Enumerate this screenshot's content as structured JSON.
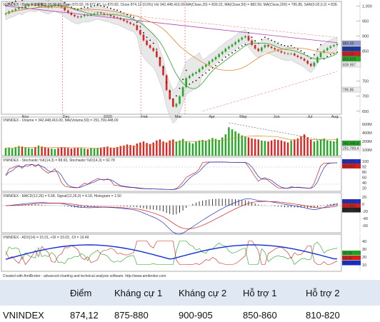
{
  "chart_data": [
    {
      "type": "candlestick",
      "title": "VNINDEX - Daily 8/25/2020 00:00:00 Open 870.92, Hi 877.37, Lo 870.82, Close 874.12 (0.6%) Vol 342,448,416.00 MA(Close,20) = 839.22, MA(Close,50) = 882.59, MA(Close,200) = 795.85, SAR(0.02,0.2) = 839.",
      "x_labels": [
        "Nov",
        "Dec",
        "2020",
        "Feb",
        "Mar",
        "Apr",
        "May",
        "Jun",
        "Jul",
        "Aug"
      ],
      "y_ticks": [
        1000,
        950,
        900,
        850,
        750,
        700,
        650
      ],
      "price_tags": [
        "882.59",
        "874.13",
        "873.94",
        "853.629",
        "839.957",
        "795.85"
      ],
      "close": [
        975,
        982,
        985,
        990,
        996,
        993,
        1000,
        1004,
        1005,
        1002,
        1008,
        1002,
        998,
        995,
        1000,
        1004,
        1000,
        995,
        985,
        978,
        970,
        965,
        962,
        966,
        970,
        968,
        972,
        975,
        978,
        975,
        972,
        970,
        966,
        962,
        960,
        955,
        950,
        945,
        940,
        936,
        920,
        905,
        885,
        870,
        860,
        850,
        830,
        800,
        770,
        720,
        690,
        665,
        675,
        700,
        730,
        760,
        768,
        775,
        780,
        790,
        798,
        805,
        815,
        822,
        830,
        840,
        848,
        858,
        865,
        872,
        880,
        888,
        895,
        900,
        885,
        870,
        858,
        850,
        862,
        870,
        865,
        860,
        855,
        850,
        845,
        842,
        840,
        842,
        835,
        830,
        825,
        818,
        808,
        800,
        812,
        830,
        845,
        852,
        860,
        866,
        870,
        874
      ],
      "ma50": [
        null,
        null,
        null,
        null,
        null,
        null,
        null,
        null,
        null,
        null,
        null,
        null,
        null,
        null,
        null,
        null,
        null,
        null,
        null,
        null,
        null,
        null,
        null,
        null,
        null,
        null,
        null,
        null,
        null,
        null,
        null,
        null,
        null,
        null,
        null,
        null,
        null,
        null,
        null,
        null,
        null,
        null,
        null,
        null,
        null,
        null,
        null,
        null,
        null,
        null,
        null,
        null,
        null,
        null,
        null,
        null,
        null,
        null,
        null,
        null,
        null,
        null,
        null,
        null,
        null,
        null,
        null,
        null,
        null,
        null,
        null,
        null,
        null,
        null,
        null,
        null,
        null,
        null,
        null,
        null,
        null,
        null,
        null,
        null,
        null,
        null,
        null,
        null,
        null,
        null,
        null,
        null,
        null,
        null,
        null,
        null,
        null,
        null,
        null,
        null,
        null,
        882.59
      ],
      "ma200": 795.85,
      "ma20": 839.22
    },
    {
      "type": "bar",
      "title": "VNINDEX - Volume = 342,448,416.00, MA(Volume,50) = 251,769,448.00",
      "y_ticks": [
        "600M",
        "400M",
        "200M",
        "100M"
      ],
      "price_tags": [
        "342,448,4",
        "251,769,4"
      ],
      "values": [
        150,
        160,
        140,
        170,
        190,
        180,
        160,
        150,
        140,
        170,
        200,
        180,
        160,
        150,
        140,
        130,
        150,
        170,
        160,
        150,
        140,
        150,
        160,
        150,
        140,
        130,
        150,
        140,
        150,
        160,
        170,
        180,
        160,
        150,
        170,
        190,
        200,
        220,
        210,
        200,
        240,
        260,
        280,
        250,
        230,
        260,
        300,
        320,
        280,
        260,
        300,
        320,
        280,
        300,
        330,
        280,
        260,
        240,
        280,
        300,
        310,
        290,
        320,
        350,
        330,
        310,
        360,
        420,
        560,
        520,
        480,
        440,
        400,
        380,
        360,
        340,
        330,
        320,
        300,
        290,
        280,
        300,
        320,
        310,
        300,
        280,
        260,
        300,
        320,
        340,
        380,
        420,
        360,
        320,
        280,
        300,
        320,
        340,
        300,
        290,
        280,
        342
      ]
    },
    {
      "type": "line",
      "title": "VNINDEX - Stochastic %K(14,3) = 88.93, Stochastic %D(14,3) = 92.78",
      "y_ticks": [
        "100",
        "92",
        "80",
        "60",
        "40",
        "20"
      ],
      "price_tags": [
        "92.7841",
        "88.9307"
      ]
    },
    {
      "type": "line",
      "title": "VNINDEX - MACD(12,26) = 5.68, Signal(12,26,9) = 4.18, Histogram = 1.50",
      "y_ticks": [
        "20",
        "0",
        "-20",
        "-40",
        "-60"
      ],
      "price_tags": [
        "5.67523",
        "4.17863",
        "1.49660"
      ]
    },
    {
      "type": "line",
      "title": "VNINDEX - ADX(14) = 15.01, +DI = 33.03, -DI = 19.49",
      "y_ticks": [
        "40",
        "30",
        "20",
        "10"
      ],
      "price_tags": [
        "33.03",
        "19.49",
        "15.0148"
      ]
    }
  ],
  "credit": "Created with AmiBroker - advanced charting and technical analysis software. http://www.amibroker.com",
  "table": {
    "headers": [
      "",
      "Điểm",
      "Kháng cự 1",
      "Kháng cự 2",
      "Hỗ trợ 1",
      "Hỗ trợ 2"
    ],
    "row": [
      "VNINDEX",
      "874,12",
      "875-880",
      "900-905",
      "850-860",
      "810-820"
    ]
  },
  "colors": {
    "up": "#22aa22",
    "down": "#dd2222",
    "table_header": "#dfe8f3"
  }
}
